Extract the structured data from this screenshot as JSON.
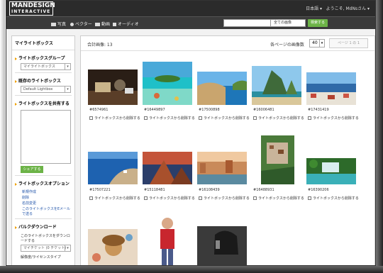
{
  "header": {
    "logo_line1": "MANDESIGN",
    "logo_line2": "INTERACTIVE",
    "language": "日本語 ▾",
    "welcome": "ようこそ, MdNsさん ▾"
  },
  "nav": {
    "items": [
      "写真",
      "ベクター",
      "動画",
      "オーディオ"
    ],
    "search_placeholder": "",
    "search_scope": "全ての画像",
    "search_button": "検索する"
  },
  "sidebar": {
    "title": "マイライトボックス",
    "group_heading": "ライトボックスグループ",
    "group_select": "マイライトボックス",
    "current_heading": "既存のライトボックス",
    "current_select": "Default Lightbox",
    "share_heading": "ライトボックスを共有する",
    "share_button": "シェアする",
    "options_heading": "ライトボックスオプション",
    "options": [
      "新規作成",
      "削除",
      "名前変更",
      "このライトボックスをEメールで送る"
    ],
    "bulk_heading": "バルクダウンロード",
    "bulk_text": "このライトボックスをダウンロードする",
    "bulk_select": "マイチケット (0 チケット)",
    "license_text": "解像度/ライセンスタイプ"
  },
  "toolbar": {
    "total": "合計画像: 13",
    "per_page_label": "各ページの画像数",
    "per_page_value": "40",
    "pager": "ページ 1 の 1"
  },
  "remove_label": "ライトボックスから削除する",
  "images": [
    {
      "id": "#6574961",
      "icon": "antique-desk-photo"
    },
    {
      "id": "#16449897",
      "icon": "tropical-island-photo"
    },
    {
      "id": "#17500898",
      "icon": "coastal-bay-photo"
    },
    {
      "id": "#16006481",
      "icon": "karst-island-photo"
    },
    {
      "id": "#17431419",
      "icon": "seaside-village-photo"
    },
    {
      "id": "#17507221",
      "icon": "harbor-town-photo"
    },
    {
      "id": "#15118481",
      "icon": "desert-mountain-photo"
    },
    {
      "id": "#16108439",
      "icon": "river-city-photo"
    },
    {
      "id": "#16488931",
      "icon": "aerial-village-photo"
    },
    {
      "id": "#16390206",
      "icon": "waterfall-photo"
    },
    {
      "id": "",
      "icon": "fashion-woman-photo"
    },
    {
      "id": "",
      "icon": "man-red-jacket-photo"
    },
    {
      "id": "",
      "icon": "woman-phone-photo"
    }
  ]
}
